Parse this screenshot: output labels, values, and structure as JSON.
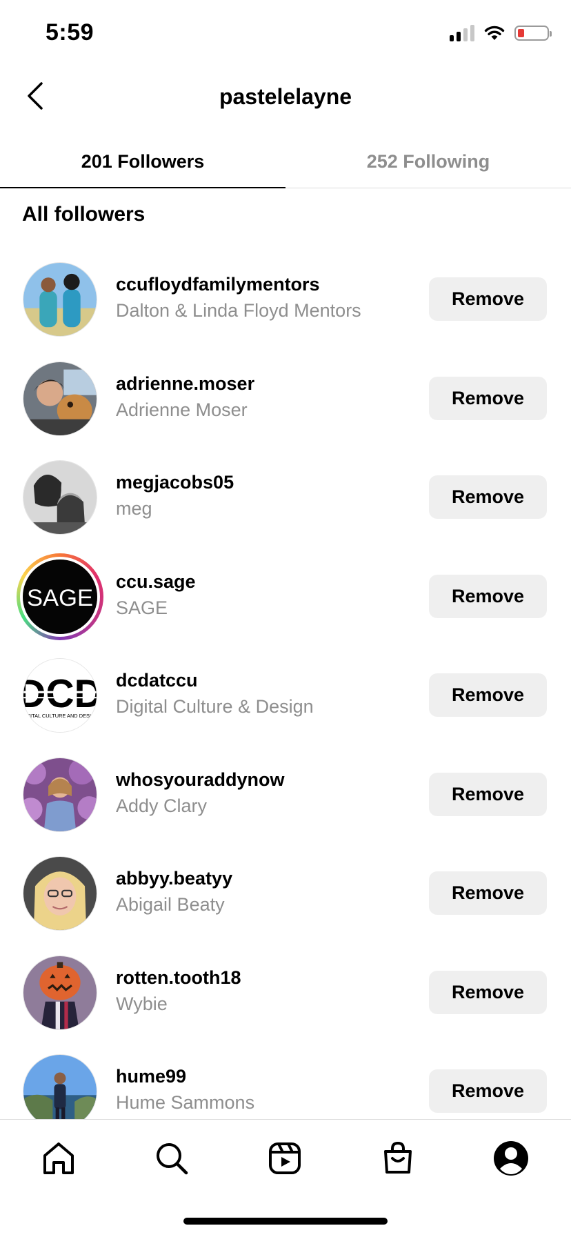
{
  "status_bar": {
    "time": "5:59",
    "battery_color": "#e53935"
  },
  "header": {
    "title": "pastelelayne",
    "back_icon": "chevron-left-icon"
  },
  "tabs": [
    {
      "label": "201 Followers",
      "active": true
    },
    {
      "label": "252 Following",
      "active": false
    }
  ],
  "section_title": "All followers",
  "followers": [
    {
      "username": "ccufloydfamilymentors",
      "full_name": "Dalton & Linda Floyd Mentors",
      "button": "Remove"
    },
    {
      "username": "adrienne.moser",
      "full_name": "Adrienne Moser",
      "button": "Remove"
    },
    {
      "username": "megjacobs05",
      "full_name": "meg",
      "button": "Remove"
    },
    {
      "username": "ccu.sage",
      "full_name": "SAGE",
      "button": "Remove",
      "avatar_text": "SAGE",
      "has_story": true
    },
    {
      "username": "dcdatccu",
      "full_name": "Digital Culture & Design",
      "button": "Remove",
      "avatar_text": "DCD",
      "avatar_subtext": "DIGITAL CULTURE AND DESIGN"
    },
    {
      "username": "whosyouraddynow",
      "full_name": "Addy Clary",
      "button": "Remove"
    },
    {
      "username": "abbyy.beatyy",
      "full_name": "Abigail Beaty",
      "button": "Remove"
    },
    {
      "username": "rotten.tooth18",
      "full_name": "Wybie",
      "button": "Remove"
    },
    {
      "username": "hume99",
      "full_name": "Hume Sammons",
      "button": "Remove"
    }
  ],
  "bottom_nav": [
    "home-icon",
    "search-icon",
    "reels-icon",
    "shop-icon",
    "profile-icon"
  ]
}
